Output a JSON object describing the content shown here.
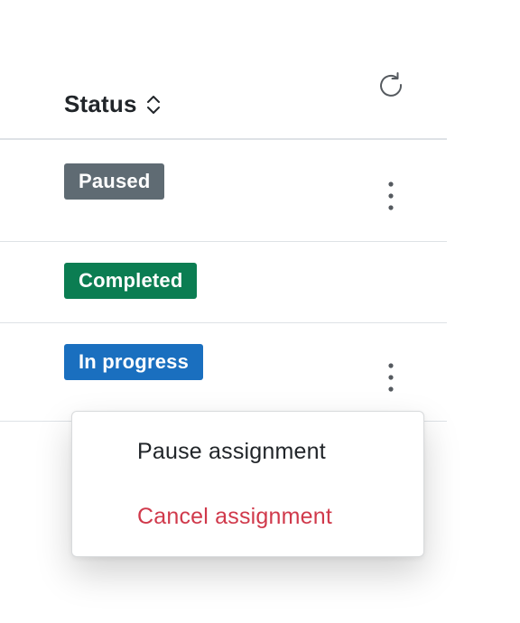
{
  "header": {
    "status_label": "Status",
    "sort_icon": "chevron-up-down-icon",
    "refresh_icon": "refresh-icon"
  },
  "rows": [
    {
      "status": "Paused",
      "badge_color": "#5f6b73",
      "has_menu": true
    },
    {
      "status": "Completed",
      "badge_color": "#0b7d52",
      "has_menu": false
    },
    {
      "status": "In progress",
      "badge_color": "#1a6fbf",
      "has_menu": true
    }
  ],
  "menu": {
    "items": [
      {
        "label": "Pause assignment",
        "color": "#212529"
      },
      {
        "label": "Cancel assignment",
        "color": "#d0394b"
      }
    ]
  }
}
